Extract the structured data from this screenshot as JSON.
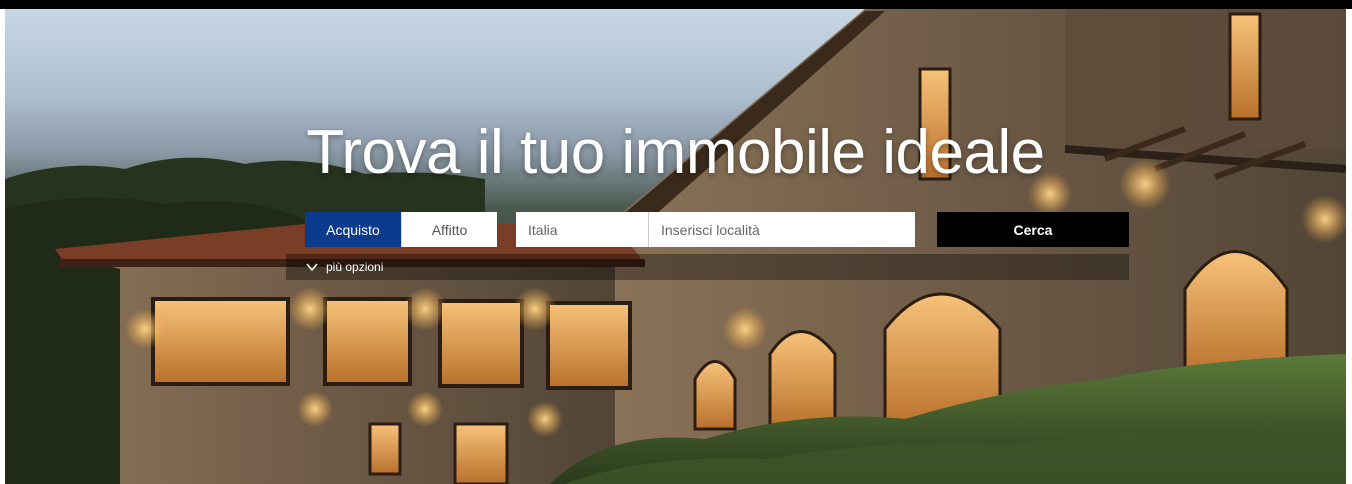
{
  "hero": {
    "headline": "Trova il tuo immobile ideale"
  },
  "search": {
    "tabs": [
      {
        "label": "Acquisto",
        "active": true
      },
      {
        "label": "Affitto",
        "active": false
      }
    ],
    "country_placeholder": "Italia",
    "location_placeholder": "Inserisci località",
    "button_label": "Cerca",
    "more_options_label": "più opzioni",
    "more_options_icon": "chevron-down-icon"
  },
  "colors": {
    "active_tab": "#0b3b8c",
    "search_button": "#000000"
  }
}
